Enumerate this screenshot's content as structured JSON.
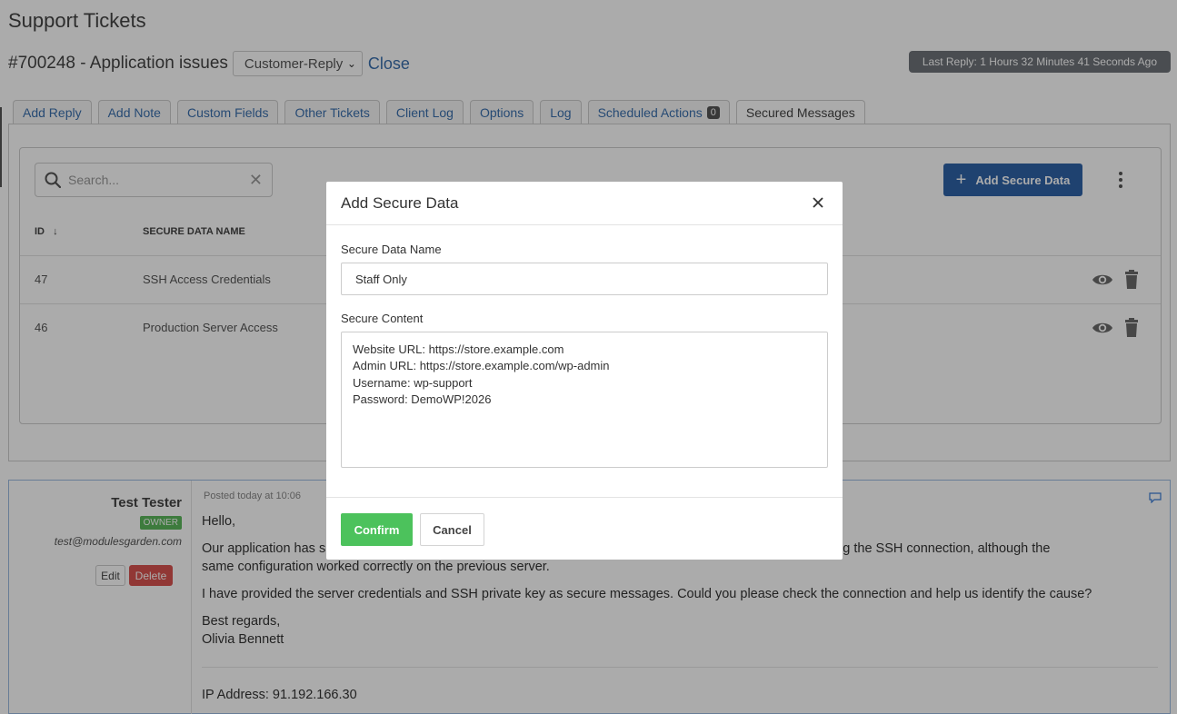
{
  "page": {
    "title": "Support Tickets"
  },
  "ticket": {
    "number_title": "#700248 - Application issues",
    "status": "Customer-Reply",
    "close_label": "Close",
    "last_reply": "Last Reply: 1 Hours 32 Minutes 41 Seconds Ago"
  },
  "tabs": [
    {
      "label": "Add Reply"
    },
    {
      "label": "Add Note"
    },
    {
      "label": "Custom Fields"
    },
    {
      "label": "Other Tickets"
    },
    {
      "label": "Client Log"
    },
    {
      "label": "Options"
    },
    {
      "label": "Log"
    },
    {
      "label": "Scheduled Actions",
      "badge": "0"
    },
    {
      "label": "Secured Messages",
      "active": true
    }
  ],
  "secured": {
    "search_placeholder": "Search...",
    "add_button": "Add Secure Data",
    "columns": {
      "id": "ID",
      "name": "SECURE DATA NAME"
    },
    "rows": [
      {
        "id": "47",
        "name": "SSH Access Credentials"
      },
      {
        "id": "46",
        "name": "Production Server Access"
      }
    ]
  },
  "post": {
    "author": "Test Tester",
    "role": "OWNER",
    "email": "test@modulesgarden.com",
    "edit_label": "Edit",
    "delete_label": "Delete",
    "posted": "Posted today at 10:06",
    "greeting": "Hello,",
    "line1a": "Our application has s",
    "line1b": "ile establishing the SSH connection, although the",
    "line2": "same configuration worked correctly on the previous server.",
    "line3": "I have provided the server credentials and SSH private key as secure messages. Could you please check the connection and help us identify the cause?",
    "signoff": "Best regards,",
    "signature": "Olivia Bennett",
    "ip": "IP Address: 91.192.166.30"
  },
  "modal": {
    "title": "Add Secure Data",
    "name_label": "Secure Data Name",
    "name_value": "Staff Only",
    "content_label": "Secure Content",
    "content_lines": [
      "Website URL: https://store.example.com",
      "Admin URL: https://store.example.com/wp-admin",
      "Username: wp-support",
      "Password: DemoWP!2026"
    ],
    "confirm": "Confirm",
    "cancel": "Cancel"
  },
  "colors": {
    "primary": "#2f63a8",
    "confirm": "#4cc25c",
    "danger": "#d9534f",
    "owner_badge": "#5cb85c",
    "link": "#3a6fad"
  }
}
